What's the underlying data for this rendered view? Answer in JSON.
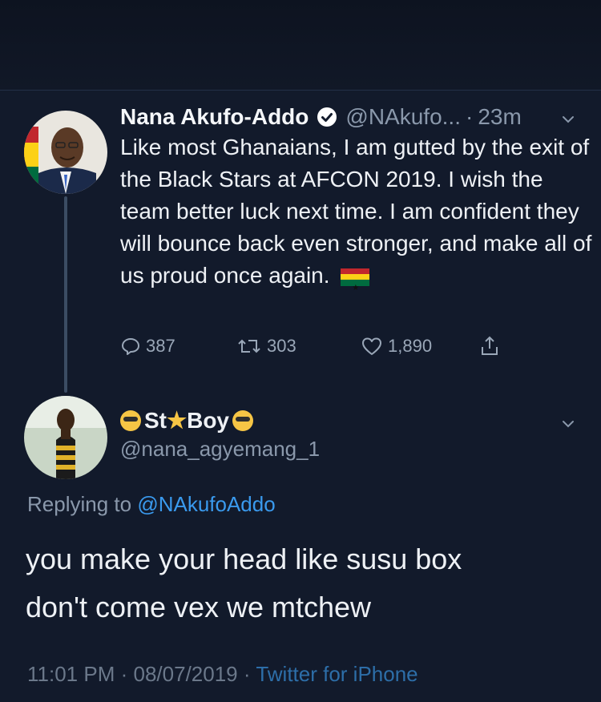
{
  "tweet": {
    "author_name": "Nana Akufo-Addo",
    "handle": "@NAkufo...",
    "separator": "·",
    "time": "23m",
    "text": "Like most Ghanaians, I am gutted by the exit of the Black Stars at AFCON 2019. I wish the team better luck next time. I am confident they will bounce back even stronger, and make all of us proud once again.",
    "actions": {
      "replies": "387",
      "retweets": "303",
      "likes": "1,890"
    }
  },
  "reply": {
    "display_name_part1": "St",
    "display_name_part2": "Boy",
    "handle": "@nana_agyemang_1",
    "replying_prefix": "Replying to",
    "replying_to": "@NAkufoAddo",
    "text_line1": "you make your head like susu box",
    "text_line2": "don't come vex we mtchew",
    "time": "11:01 PM",
    "date": "08/07/2019",
    "separator": "·",
    "source": "Twitter for iPhone"
  },
  "colors": {
    "background": "#121a2b",
    "link": "#3a9aee",
    "muted": "#8a98ab",
    "verified": "#ffffff"
  },
  "icons": [
    "verified-badge-icon",
    "chevron-down-icon",
    "reply-icon",
    "retweet-icon",
    "like-icon",
    "share-icon",
    "ghana-flag-icon",
    "star-struck-emoji-icon",
    "star-icon"
  ]
}
